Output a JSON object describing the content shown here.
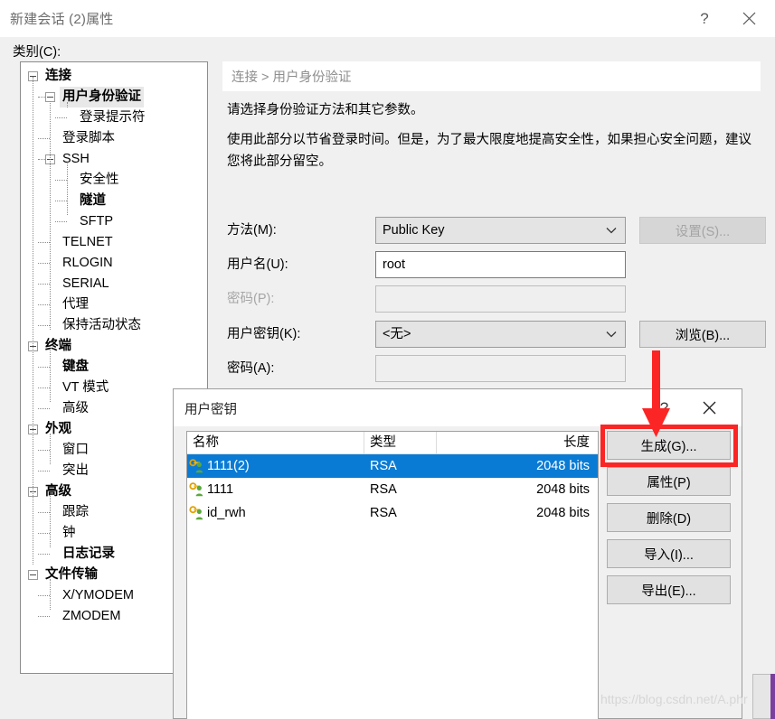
{
  "window": {
    "title": "新建会话 (2)属性",
    "help_label": "?",
    "close_label": "✕",
    "category_label": "类别(C):"
  },
  "tree": {
    "nodes": [
      {
        "label": "连接",
        "depth": 0,
        "toggle": true,
        "bold": true,
        "selected": false
      },
      {
        "label": "用户身份验证",
        "depth": 1,
        "toggle": true,
        "bold": true,
        "selected": true
      },
      {
        "label": "登录提示符",
        "depth": 2,
        "toggle": false,
        "bold": false,
        "selected": false
      },
      {
        "label": "登录脚本",
        "depth": 1,
        "toggle": false,
        "bold": false,
        "selected": false
      },
      {
        "label": "SSH",
        "depth": 1,
        "toggle": true,
        "bold": false,
        "selected": false
      },
      {
        "label": "安全性",
        "depth": 2,
        "toggle": false,
        "bold": false,
        "selected": false
      },
      {
        "label": "隧道",
        "depth": 2,
        "toggle": false,
        "bold": true,
        "selected": false
      },
      {
        "label": "SFTP",
        "depth": 2,
        "toggle": false,
        "bold": false,
        "selected": false
      },
      {
        "label": "TELNET",
        "depth": 1,
        "toggle": false,
        "bold": false,
        "selected": false
      },
      {
        "label": "RLOGIN",
        "depth": 1,
        "toggle": false,
        "bold": false,
        "selected": false
      },
      {
        "label": "SERIAL",
        "depth": 1,
        "toggle": false,
        "bold": false,
        "selected": false
      },
      {
        "label": "代理",
        "depth": 1,
        "toggle": false,
        "bold": false,
        "selected": false
      },
      {
        "label": "保持活动状态",
        "depth": 1,
        "toggle": false,
        "bold": false,
        "selected": false
      },
      {
        "label": "终端",
        "depth": 0,
        "toggle": true,
        "bold": true,
        "selected": false
      },
      {
        "label": "键盘",
        "depth": 1,
        "toggle": false,
        "bold": true,
        "selected": false
      },
      {
        "label": "VT 模式",
        "depth": 1,
        "toggle": false,
        "bold": false,
        "selected": false
      },
      {
        "label": "高级",
        "depth": 1,
        "toggle": false,
        "bold": false,
        "selected": false
      },
      {
        "label": "外观",
        "depth": 0,
        "toggle": true,
        "bold": true,
        "selected": false
      },
      {
        "label": "窗口",
        "depth": 1,
        "toggle": false,
        "bold": false,
        "selected": false
      },
      {
        "label": "突出",
        "depth": 1,
        "toggle": false,
        "bold": false,
        "selected": false
      },
      {
        "label": "高级",
        "depth": 0,
        "toggle": true,
        "bold": true,
        "selected": false
      },
      {
        "label": "跟踪",
        "depth": 1,
        "toggle": false,
        "bold": false,
        "selected": false
      },
      {
        "label": "钟",
        "depth": 1,
        "toggle": false,
        "bold": false,
        "selected": false
      },
      {
        "label": "日志记录",
        "depth": 1,
        "toggle": false,
        "bold": true,
        "selected": false
      },
      {
        "label": "文件传输",
        "depth": 0,
        "toggle": true,
        "bold": true,
        "selected": false
      },
      {
        "label": "X/YMODEM",
        "depth": 1,
        "toggle": false,
        "bold": false,
        "selected": false
      },
      {
        "label": "ZMODEM",
        "depth": 1,
        "toggle": false,
        "bold": false,
        "selected": false
      }
    ]
  },
  "content": {
    "breadcrumb": "连接 > 用户身份验证",
    "description_1": "请选择身份验证方法和其它参数。",
    "description_2": "使用此部分以节省登录时间。但是，为了最大限度地提高安全性，如果担心安全问题，建议您将此部分留空。",
    "fields": {
      "method": {
        "label": "方法(M):",
        "value": "Public Key",
        "button": "设置(S)...",
        "button_disabled": true
      },
      "username": {
        "label": "用户名(U):",
        "value": "root"
      },
      "password": {
        "label": "密码(P):",
        "value": "",
        "disabled": true
      },
      "userkey": {
        "label": "用户密钥(K):",
        "value": "<无>",
        "button": "浏览(B)..."
      },
      "passphrase": {
        "label": "密码(A):",
        "value": ""
      }
    }
  },
  "modal": {
    "title": "用户密钥",
    "help_label": "?",
    "close_label": "✕",
    "columns": [
      "名称",
      "类型",
      "长度"
    ],
    "rows": [
      {
        "name": "1111(2)",
        "type": "RSA",
        "length": "2048 bits",
        "selected": true
      },
      {
        "name": "1111",
        "type": "RSA",
        "length": "2048 bits",
        "selected": false
      },
      {
        "name": "id_rwh",
        "type": "RSA",
        "length": "2048 bits",
        "selected": false
      }
    ],
    "buttons": [
      {
        "label": "生成(G)...",
        "highlighted": true
      },
      {
        "label": "属性(P)",
        "highlighted": false
      },
      {
        "label": "删除(D)",
        "highlighted": false
      },
      {
        "label": "导入(I)...",
        "highlighted": false
      },
      {
        "label": "导出(E)...",
        "highlighted": false
      }
    ]
  },
  "annotation": {
    "highlight_color": "#fb2525",
    "arrow_color": "#fb2525",
    "arrow_from": "浏览(B)...",
    "arrow_to": "生成(G)..."
  },
  "watermark": {
    "text": "https://blog.csdn.net/A.phr"
  }
}
